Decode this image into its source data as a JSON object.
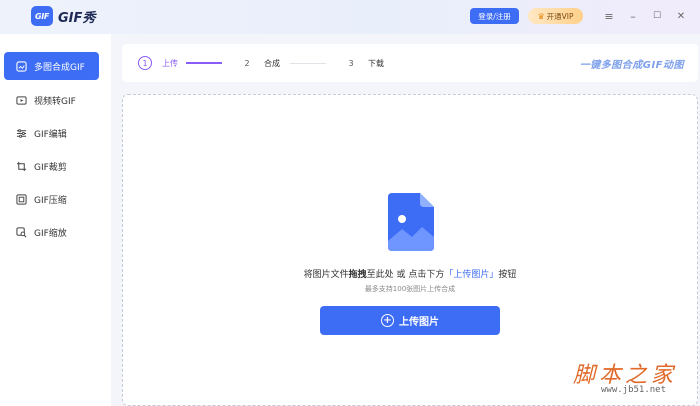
{
  "app": {
    "logo_text": "GIF",
    "title": "GIF秀"
  },
  "titlebar": {
    "login_label": "登录/注册",
    "vip_label": "开通VIP",
    "menu_icon": "≡",
    "minimize_icon": "–",
    "maximize_icon": "☐",
    "close_icon": "✕"
  },
  "sidebar": {
    "items": [
      {
        "label": "多图合成GIF",
        "icon": "image-compose-icon",
        "active": true
      },
      {
        "label": "视频转GIF",
        "icon": "video-icon",
        "active": false
      },
      {
        "label": "GIF编辑",
        "icon": "sliders-icon",
        "active": false
      },
      {
        "label": "GIF裁剪",
        "icon": "crop-icon",
        "active": false
      },
      {
        "label": "GIF压缩",
        "icon": "compress-icon",
        "active": false
      },
      {
        "label": "GIF缩放",
        "icon": "zoom-icon",
        "active": false
      }
    ]
  },
  "steps": {
    "items": [
      {
        "num": "1",
        "label": "上传"
      },
      {
        "num": "2",
        "label": "合成"
      },
      {
        "num": "3",
        "label": "下载"
      }
    ],
    "slogan": "一键多图合成GIF动图"
  },
  "dropzone": {
    "hint_prefix": "将图片文件",
    "hint_bold": "拖拽",
    "hint_mid": "至此处 或 点击下方",
    "hint_highlight": "「上传图片」",
    "hint_suffix": "按钮",
    "subhint": "最多支持100张图片上传合成",
    "upload_label": "上传图片"
  },
  "watermark": {
    "main": "脚本之家",
    "sub": "www.jb51.net"
  },
  "colors": {
    "accent": "#3d6cf5",
    "step_active": "#8a5cf6"
  }
}
